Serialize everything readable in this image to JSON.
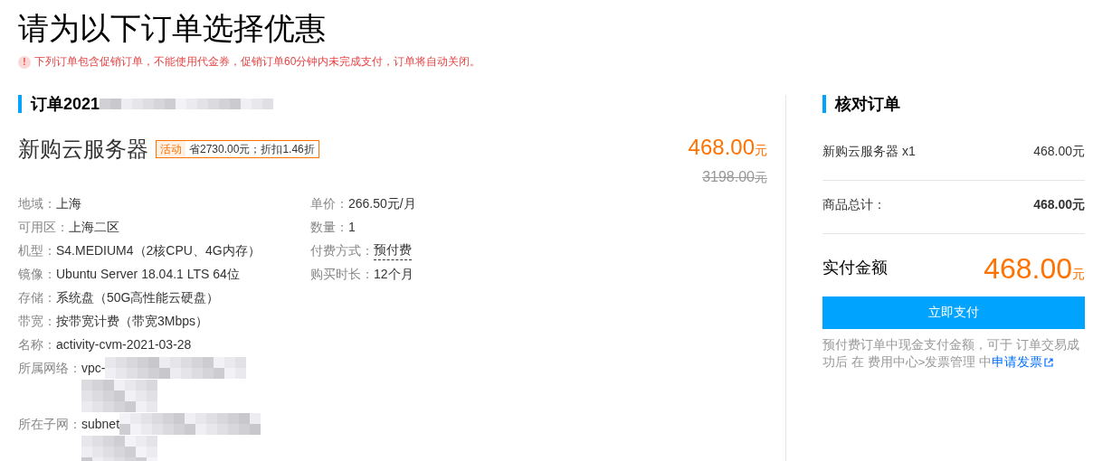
{
  "title": "请为以下订单选择优惠",
  "notice": {
    "icon": "!",
    "text": "下列订单包含促销订单，不能使用代金券，促销订单60分钟内未完成支付，订单将自动关闭。"
  },
  "order": {
    "heading": "订单2021",
    "product": "新购云服务器",
    "tag": {
      "label": "活动",
      "text": "省2730.00元；折扣1.46折"
    },
    "price": "468.00",
    "price_unit": "元",
    "original_price": "3198.00",
    "original_unit": "元",
    "details_left": [
      {
        "label": "地域：",
        "value": "上海",
        "kind": "plain"
      },
      {
        "label": "可用区：",
        "value": "上海二区",
        "kind": "plain"
      },
      {
        "label": "机型：",
        "value": "S4.MEDIUM4（2核CPU、4G内存）",
        "kind": "plain"
      },
      {
        "label": "镜像：",
        "value": "Ubuntu Server 18.04.1 LTS 64位",
        "kind": "plain"
      },
      {
        "label": "存储：",
        "value": "系统盘（50G高性能云硬盘）",
        "kind": "plain"
      },
      {
        "label": "带宽：",
        "value": "按带宽计费（带宽3Mbps）",
        "kind": "plain"
      },
      {
        "label": "名称：",
        "value": "activity-cvm-2021-03-28",
        "kind": "plain"
      },
      {
        "label": "所属网络：",
        "value": "vpc-",
        "kind": "redacted"
      },
      {
        "label": "所在子网：",
        "value": "subnet",
        "kind": "redacted"
      }
    ],
    "details_right": [
      {
        "label": "单价：",
        "value": "266.50元/月",
        "kind": "plain"
      },
      {
        "label": "数量：",
        "value": "1",
        "kind": "plain"
      },
      {
        "label": "付费方式：",
        "value": "预付费",
        "kind": "dashed"
      },
      {
        "label": "购买时长：",
        "value": "12个月",
        "kind": "plain"
      }
    ]
  },
  "summary": {
    "heading": "核对订单",
    "item_name": "新购云服务器 x1",
    "item_price": "468.00元",
    "subtotal_label": "商品总计：",
    "subtotal_value": "468.00元",
    "total_label": "实付金额",
    "total_amount": "468.00",
    "total_unit": "元",
    "pay_button": "立即支付",
    "note": "预付费订单中现金支付金额，可于 订单交易成功后 在 费用中心>发票管理 中",
    "note_link": "申请发票"
  }
}
